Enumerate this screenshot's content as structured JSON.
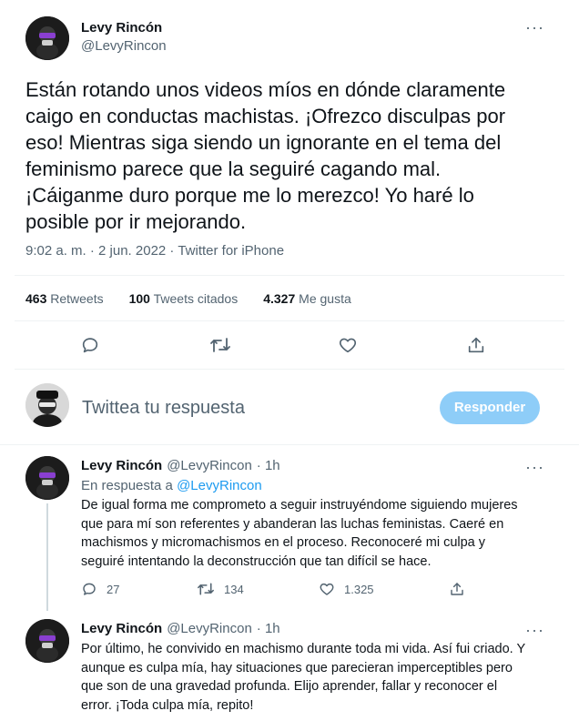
{
  "main_tweet": {
    "author_name": "Levy Rincón",
    "author_handle": "@LevyRincon",
    "more_label": "···",
    "text_lines": [
      "Están rotando unos videos míos en dónde claramente",
      "caigo en conductas machistas. ¡Ofrezco disculpas por",
      "eso! Mientras siga siendo un ignorante en el tema del",
      "feminismo parece que la seguiré cagando mal.",
      "¡Cáiganme duro porque me lo merezco! Yo haré lo",
      "posible por ir mejorando."
    ],
    "meta": "9:02 a. m. · 2 jun. 2022 · Twitter for iPhone",
    "stats": {
      "retweets_count": "463",
      "retweets_label": "Retweets",
      "quotes_count": "100",
      "quotes_label": "Tweets citados",
      "likes_count": "4.327",
      "likes_label": "Me gusta"
    },
    "actions": [
      "reply-icon",
      "retweet-icon",
      "like-icon",
      "share-icon"
    ]
  },
  "composer": {
    "placeholder": "Twittea tu respuesta",
    "button_label": "Responder"
  },
  "replies": [
    {
      "author_name": "Levy Rincón",
      "author_handle": "@LevyRincon",
      "time": "· 1h",
      "more_label": "···",
      "in_reply_prefix": "En respuesta a",
      "in_reply_handle": "@LevyRincon",
      "text_lines": [
        "De igual forma me comprometo a seguir instruyéndome siguiendo mujeres",
        "que para mí son referentes y abanderan las luchas feministas. Caeré en",
        "machismos y micromachismos en el proceso. Reconoceré mi culpa y",
        "seguiré intentando la deconstrucción que tan difícil se hace."
      ],
      "reply_count": "27",
      "retweet_count": "134",
      "like_count": "1.325"
    },
    {
      "author_name": "Levy Rincón",
      "author_handle": "@LevyRincon",
      "time": "· 1h",
      "more_label": "···",
      "text_lines": [
        "Por último, he convivido en machismo durante toda mi vida. Así fui criado. Y",
        "aunque es culpa mía, hay situaciones que parecieran imperceptibles pero",
        "que son de una gravedad profunda. Elijo aprender, fallar y reconocer el",
        "error. ¡Toda culpa mía, repito!"
      ]
    }
  ],
  "colors": {
    "accent": "#1d9bf0",
    "button_disabled": "#8ecdf8",
    "text": "#0f1419",
    "muted": "#536471",
    "divider": "#eff3f4",
    "avatar_glasses": "#8a3fd1"
  }
}
